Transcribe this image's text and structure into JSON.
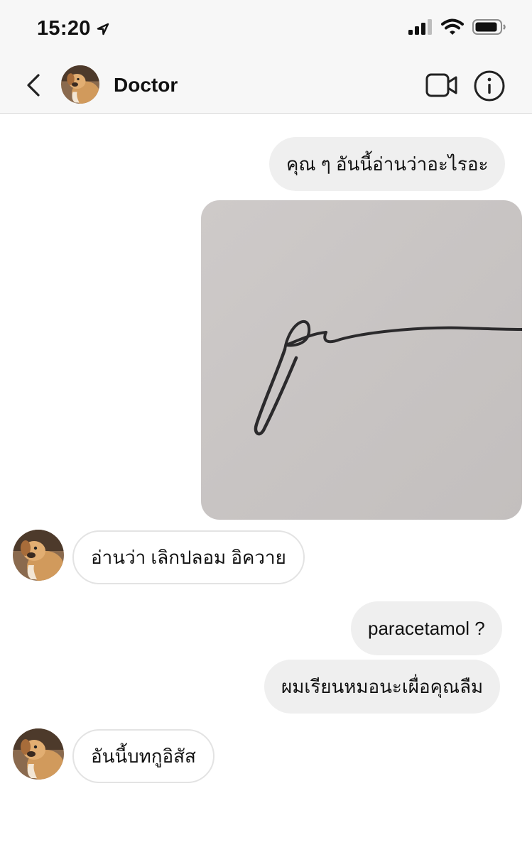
{
  "status_bar": {
    "time": "15:20",
    "icons": [
      "location-arrow-icon",
      "signal-icon",
      "wifi-icon",
      "battery-icon"
    ]
  },
  "header": {
    "title": "Doctor",
    "icons": [
      "back-chevron-icon",
      "video-call-icon",
      "info-icon"
    ]
  },
  "messages": [
    {
      "direction": "outgoing",
      "type": "text",
      "text": "คุณ ๆ อันนี้อ่านว่าอะไรอะ"
    },
    {
      "direction": "outgoing",
      "type": "image",
      "description_icon": "signature-photo"
    },
    {
      "direction": "incoming",
      "type": "text",
      "text": "อ่านว่า เลิกปลอม อิควาย"
    },
    {
      "direction": "outgoing",
      "type": "text",
      "text": "paracetamol ?"
    },
    {
      "direction": "outgoing",
      "type": "text",
      "text": "ผมเรียนหมอนะเผื่อคุณลืม"
    },
    {
      "direction": "incoming",
      "type": "text",
      "text": "อันนี้บทกูอิสัส"
    }
  ],
  "colors": {
    "outgoing_bubble": "#efefef",
    "incoming_border": "#e3e3e3",
    "header_bg": "#f7f7f7",
    "paper": "#c9c5c4"
  }
}
